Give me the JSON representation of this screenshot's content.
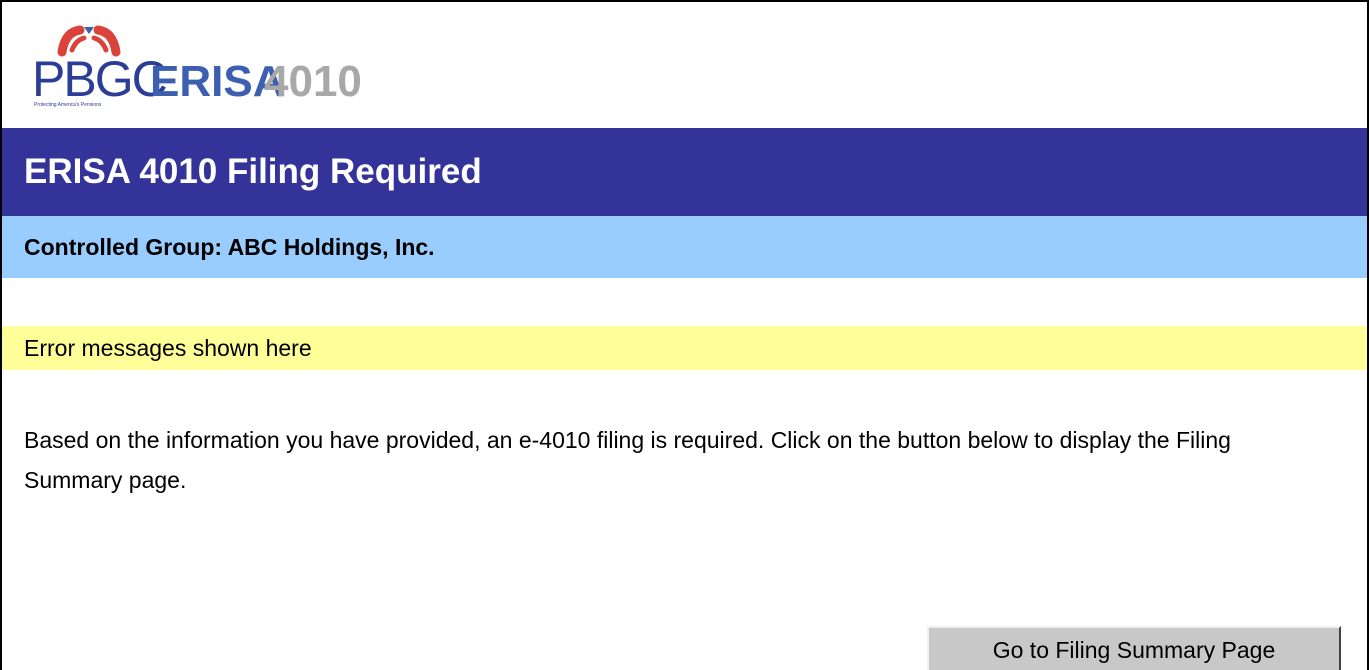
{
  "logo": {
    "brand": "PBGC",
    "product": "ERISA",
    "product_number": "4010",
    "tagline": "Protecting America's Pensions",
    "colors": {
      "brand_blue": "#2c3d97",
      "erisa_blue": "#3d5fb0",
      "number_gray": "#a8a8a8",
      "arc_red": "#d9433a",
      "arc_blue": "#3d5fb0"
    }
  },
  "header": {
    "title": "ERISA 4010 Filing Required"
  },
  "subheader": {
    "controlled_group": "Controlled Group: ABC Holdings, Inc."
  },
  "error": {
    "message": "Error messages shown here"
  },
  "main": {
    "info_text": "Based on the information you have provided, an e-4010 filing is required. Click on the button below to display the Filing Summary page."
  },
  "actions": {
    "go_summary_label": "Go to Filing Summary Page"
  },
  "colors": {
    "title_band": "#333399",
    "subheader_band": "#99ccff",
    "error_band": "#ffff99",
    "button_face": "#c8c8c8"
  }
}
